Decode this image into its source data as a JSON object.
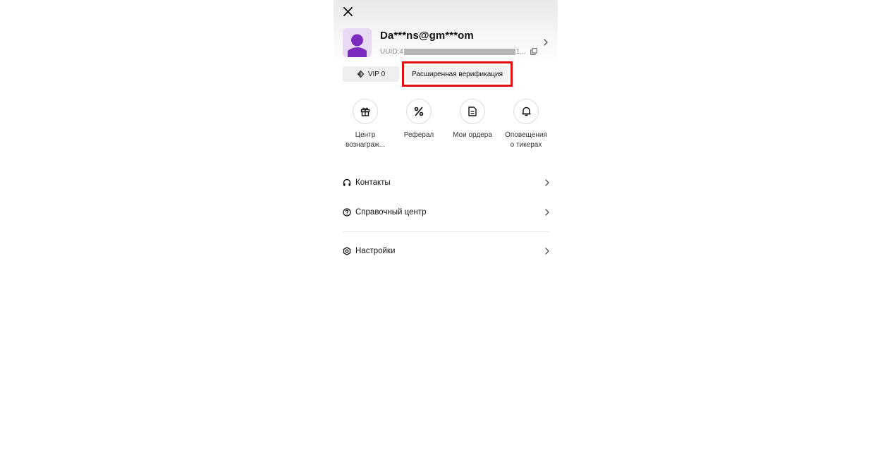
{
  "profile": {
    "name": "Da***ns@gm***om",
    "uuid_prefix": "UUID:4",
    "uuid_suffix": "1...",
    "avatar_bg": "#e8daf3",
    "avatar_fg": "#7b2cbf"
  },
  "badges": {
    "vip_label": "VIP 0",
    "verification_label": "Расширенная верификация",
    "highlight_color": "#e01010"
  },
  "quick_actions": [
    {
      "label_line1": "Центр",
      "label_line2": "вознаграж...",
      "icon": "gift-icon"
    },
    {
      "label_line1": "Реферал",
      "label_line2": "",
      "icon": "percent-icon"
    },
    {
      "label_line1": "Мои ордера",
      "label_line2": "",
      "icon": "document-icon"
    },
    {
      "label_line1": "Оповещения",
      "label_line2": "о тикерах",
      "icon": "bell-icon"
    }
  ],
  "menu": {
    "contacts": "Контакты",
    "help_center": "Справочный центр",
    "settings": "Настройки"
  }
}
